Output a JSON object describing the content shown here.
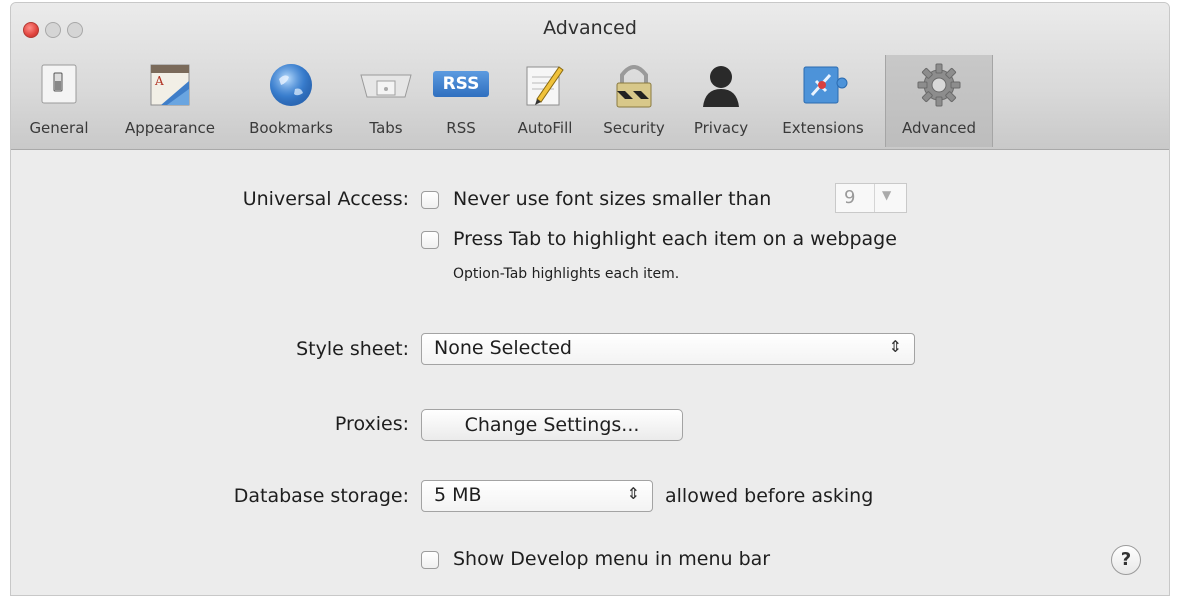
{
  "window": {
    "title": "Advanced"
  },
  "toolbar": {
    "items": [
      {
        "label": "General",
        "icon": "general-switch-icon"
      },
      {
        "label": "Appearance",
        "icon": "appearance-icon"
      },
      {
        "label": "Bookmarks",
        "icon": "globe-icon"
      },
      {
        "label": "Tabs",
        "icon": "tabs-icon"
      },
      {
        "label": "RSS",
        "icon": "rss-icon"
      },
      {
        "label": "AutoFill",
        "icon": "autofill-icon"
      },
      {
        "label": "Security",
        "icon": "padlock-icon"
      },
      {
        "label": "Privacy",
        "icon": "privacy-person-icon"
      },
      {
        "label": "Extensions",
        "icon": "extensions-icon"
      },
      {
        "label": "Advanced",
        "icon": "gear-icon",
        "active": true
      }
    ],
    "rss_badge": "RSS"
  },
  "settings": {
    "universal_access": {
      "label": "Universal Access:",
      "never_font_label": "Never use font sizes smaller than",
      "font_size_value": "9",
      "press_tab_label": "Press Tab to highlight each item on a webpage",
      "hint": "Option-Tab highlights each item."
    },
    "style_sheet": {
      "label": "Style sheet:",
      "value": "None Selected"
    },
    "proxies": {
      "label": "Proxies:",
      "button": "Change Settings..."
    },
    "database_storage": {
      "label": "Database storage:",
      "value": "5 MB",
      "suffix": "allowed before asking"
    },
    "develop_menu": {
      "label": "Show Develop menu in menu bar"
    },
    "help": "?"
  }
}
